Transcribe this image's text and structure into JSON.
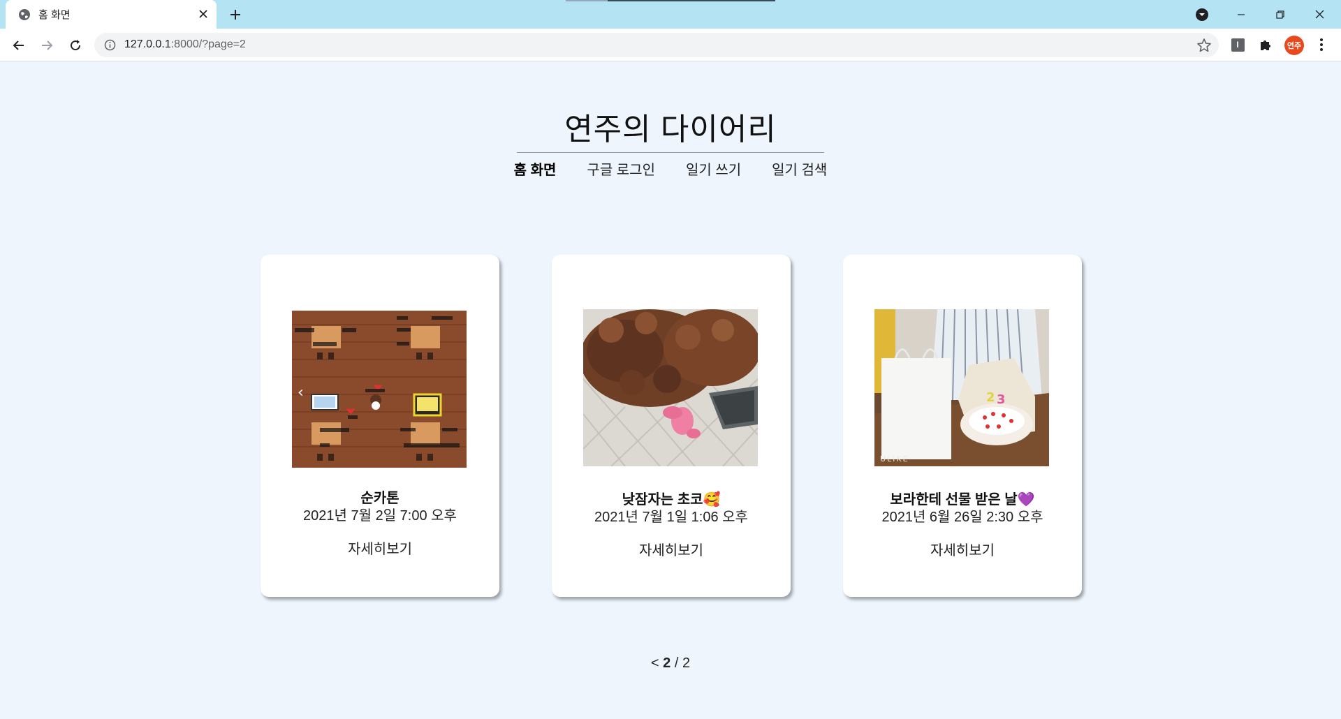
{
  "browser": {
    "tab_title": "홈 화면",
    "url_host": "127.0.0.1",
    "url_rest": ":8000/?page=2",
    "profile_initials": "연주"
  },
  "site": {
    "title": "연주의 다이어리",
    "nav": [
      {
        "label": "홈 화면",
        "active": true
      },
      {
        "label": "구글 로그인",
        "active": false
      },
      {
        "label": "일기 쓰기",
        "active": false
      },
      {
        "label": "일기 검색",
        "active": false
      }
    ]
  },
  "posts": [
    {
      "title": "순카톤",
      "date": "2021년 7월 2일 7:00 오후",
      "more": "자세히보기",
      "image": "game-map-screenshot"
    },
    {
      "title": "낮잠자는 초코🥰",
      "date": "2021년 7월 1일 1:06 오후",
      "more": "자세히보기",
      "image": "sleeping-brown-poodle"
    },
    {
      "title": "보라한테 선물 받은 날💜",
      "date": "2021년 6월 26일 2:30 오후",
      "more": "자세히보기",
      "image": "birthday-cake-gift"
    }
  ],
  "pagination": {
    "prev": "<",
    "current": "2",
    "separator": "/",
    "total": "2"
  },
  "photo_overlays": {
    "map_prev_arrow": "‹",
    "cake_watermark": "ULIKE"
  }
}
